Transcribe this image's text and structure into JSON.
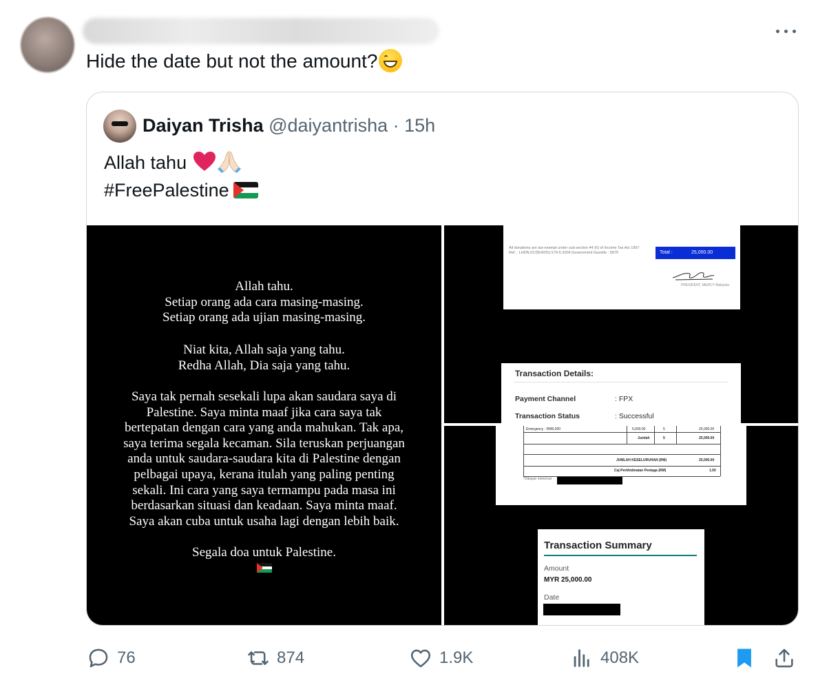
{
  "tweet": {
    "text": "Hide the date but not the amount?",
    "emoji": "grinning-face"
  },
  "quoted": {
    "name": "Daiyan Trisha",
    "handle": "@daiyantrisha",
    "separator": "·",
    "time": "15h",
    "line1": "Allah tahu",
    "line2": "#FreePalestine",
    "emojis": [
      "red-heart",
      "folded-hands",
      "palestine-flag"
    ]
  },
  "media": {
    "statement": {
      "p1": [
        "Allah tahu.",
        "Setiap orang ada cara masing-masing.",
        "Setiap orang ada ujian masing-masing."
      ],
      "p2": [
        "Niat kita, Allah saja yang tahu.",
        "Redha Allah, Dia saja yang tahu."
      ],
      "p3": [
        "Saya tak pernah sesekali lupa akan saudara saya di",
        "Palestine. Saya minta maaf jika cara saya tak",
        "bertepatan dengan cara yang anda mahukan. Tak apa,",
        "saya terima segala kecaman. Sila teruskan perjuangan",
        "anda untuk saudara-saudara kita di Palestine dengan",
        "pelbagai upaya, kerana itulah yang paling penting",
        "sekali. Ini cara yang saya termampu pada masa ini",
        "berdasarkan situasi dan keadaan. Saya minta maaf.",
        "Saya akan cuba untuk usaha lagi dengan lebih baik."
      ],
      "p4": "Segala doa untuk Palestine."
    },
    "receipt": {
      "fine1": "All donations are tax-exempt under sub-section 44 (6) of Income Tax Act 1967",
      "fine2": "Ref. : LHDN.01/35/42/51/179-6.3204 Government Gazette : 5879",
      "total_label": "Total :",
      "total_value": "25,000.00",
      "president": "PRESIDENT, MERCY Malaysia"
    },
    "transaction": {
      "title": "Transaction Details:",
      "channel_label": "Payment Channel",
      "channel_value": ": FPX",
      "status_label": "Transaction Status",
      "status_value": ": Successful"
    },
    "invoice": {
      "row1_item": "Emergency - RM5,000",
      "row1_price": "5,000.00",
      "row1_qty": "5",
      "row1_total": "25,000.00",
      "jumlah_label": "Jumlah",
      "jumlah_qty": "5",
      "jumlah_total": "25,000.00",
      "grand_label": "JUMLAH KESELURUHAN (RM)",
      "grand_value": "25,000.00",
      "fee_label": "Caj Perkhidmatan Peniaga (RM)",
      "fee_value": "1.50",
      "paid_to": "*Dibayar menerusi"
    },
    "summary": {
      "title": "Transaction Summary",
      "amount_label": "Amount",
      "amount_value": "MYR 25,000.00",
      "date_label": "Date"
    }
  },
  "actions": {
    "replies": "76",
    "reposts": "874",
    "likes": "1.9K",
    "views": "408K"
  },
  "colors": {
    "text": "#0f1419",
    "secondary": "#536471",
    "bookmark_active": "#1d9bf0",
    "border": "#cfd9de",
    "total_box": "#0b2dd6",
    "summary_rule": "#0d7c7c"
  }
}
